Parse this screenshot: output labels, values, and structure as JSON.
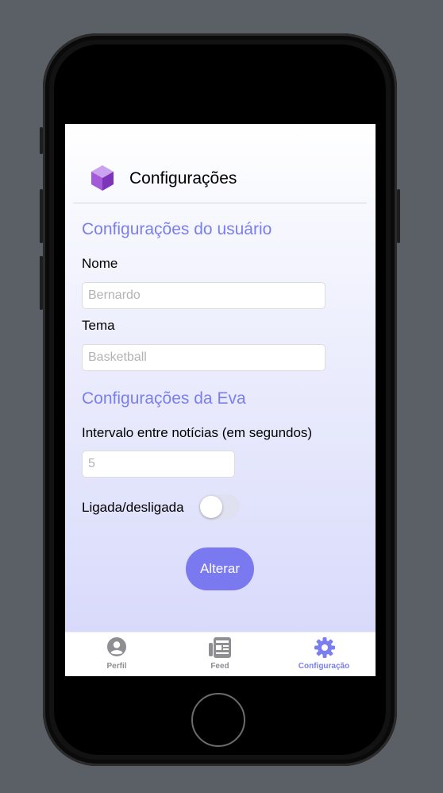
{
  "header": {
    "title": "Configurações"
  },
  "user_section": {
    "title": "Configurações do usuário",
    "name_label": "Nome",
    "name_placeholder": "Bernardo",
    "theme_label": "Tema",
    "theme_placeholder": "Basketball"
  },
  "eva_section": {
    "title": "Configurações da Eva",
    "interval_label": "Intervalo entre notícias (em segundos)",
    "interval_placeholder": "5",
    "toggle_label": "Ligada/desligada",
    "toggle_on": false
  },
  "submit_label": "Alterar",
  "tabs": [
    {
      "label": "Perfil",
      "icon": "person-circle-icon",
      "active": false
    },
    {
      "label": "Feed",
      "icon": "newspaper-icon",
      "active": false
    },
    {
      "label": "Configuração",
      "icon": "gear-icon",
      "active": true
    }
  ],
  "colors": {
    "accent": "#7b7ef0",
    "button": "#7b79f0",
    "inactive": "#8e8e93"
  }
}
